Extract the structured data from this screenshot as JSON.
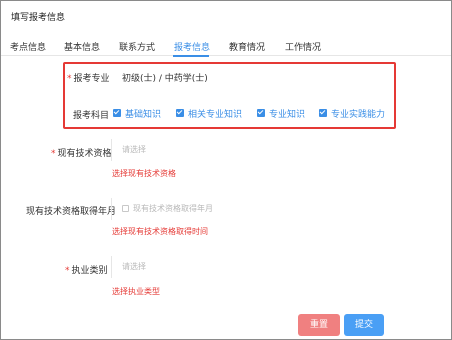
{
  "window": {
    "title": "填写报考信息"
  },
  "tabs": [
    {
      "label": "考点信息"
    },
    {
      "label": "基本信息"
    },
    {
      "label": "联系方式"
    },
    {
      "label": "报考信息"
    },
    {
      "label": "教育情况"
    },
    {
      "label": "工作情况"
    }
  ],
  "form": {
    "major": {
      "label": "报考专业",
      "value": "初级(士) / 中药学(士)"
    },
    "subjects": {
      "label": "报考科目",
      "options": [
        {
          "label": "基础知识",
          "checked": true
        },
        {
          "label": "相关专业知识",
          "checked": true
        },
        {
          "label": "专业知识",
          "checked": true
        },
        {
          "label": "专业实践能力",
          "checked": true
        }
      ]
    },
    "qualification": {
      "label": "现有技术资格",
      "placeholder": "请选择",
      "error": "选择现有技术资格"
    },
    "qual_date": {
      "label": "现有技术资格取得年月",
      "placeholder": "现有技术资格取得年月",
      "error": "选择现有技术资格取得时间"
    },
    "practice_type": {
      "label": "执业类别",
      "placeholder": "请选择",
      "error": "选择执业类型"
    }
  },
  "buttons": {
    "reset": "重置",
    "submit": "提交"
  },
  "colors": {
    "accent": "#3a8ee6",
    "error": "#e53935",
    "reset": "#f08080",
    "submit": "#4a9ff5"
  }
}
